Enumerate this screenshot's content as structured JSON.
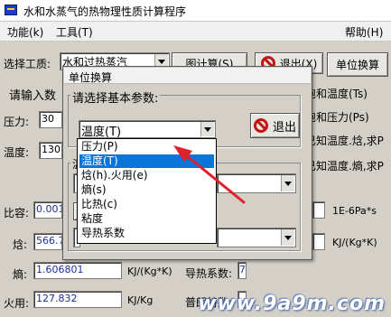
{
  "window": {
    "title": "水和水蒸气的热物理性质计算程序"
  },
  "menu": {
    "items": [
      "功能(k)",
      "工具(T)"
    ],
    "help": "帮助(H)"
  },
  "main": {
    "select_medium_label": "选择工质:",
    "medium_value": "水和过热蒸汽",
    "calc_button": "图计算(S)",
    "exit_button": "退出(X)",
    "unit_button": "单位换算",
    "input_label": "请输入数",
    "pressure_label": "压力:",
    "pressure_value": "30",
    "temperature_label": "温度:",
    "temperature_value": "130",
    "right_options": [
      "饱和温度(Ts)",
      "饱和压力(Ps)",
      "已知温度.焓,求P",
      "已知温度.熵,求P"
    ],
    "volume_label": "比容:",
    "volume_value": "0.001",
    "viscosity_unit": "1E-6Pa*s",
    "enthalpy_label": "焓:",
    "enthalpy_value": "566.7",
    "enthalpy_unit": "KJ/(Kg*K)",
    "entropy_label": "熵:",
    "entropy_value": "1.606801",
    "entropy_unit": "KJ/(Kg*K)",
    "conductivity_label": "导热系数:",
    "conductivity_value": "7",
    "exergy_label": "火用:",
    "exergy_value": "127.832",
    "exergy_unit": "KJ/Kg",
    "prandtl_label": "普朗特数:"
  },
  "dialog": {
    "title": "单位换算",
    "prompt": "请选择基本参数:",
    "combo_value": "温度(T)",
    "exit_button": "退出",
    "group2_label": "温",
    "options": [
      "压力(P)",
      "温度(T)",
      "焓(h).火用(e)",
      "熵(s)",
      "比热(c)",
      "粘度",
      "导热系数"
    ],
    "selected_index": 1
  },
  "watermark": "www.9a9m.com",
  "colors": {
    "selection": "#0a74d8",
    "value_text": "#1a2ea6",
    "arrow": "#e0202a",
    "icon_red": "#c01616"
  }
}
